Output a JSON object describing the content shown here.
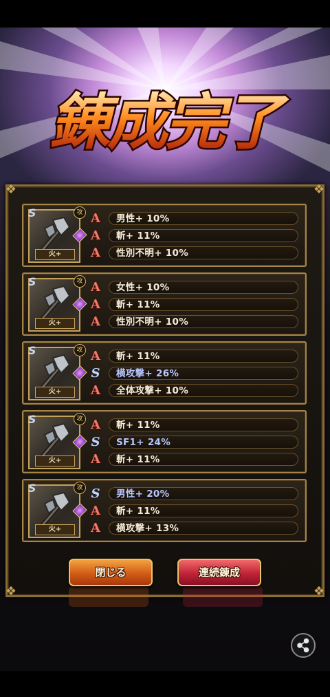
{
  "title": "錬成完了",
  "cards": [
    {
      "element_label": "火+",
      "badge": "攻",
      "rows": [
        {
          "rank": "A",
          "text": "男性+ 10%",
          "tone": "normal"
        },
        {
          "rank": "A",
          "text": "斬+ 11%",
          "tone": "normal"
        },
        {
          "rank": "A",
          "text": "性別不明+ 10%",
          "tone": "normal"
        }
      ]
    },
    {
      "element_label": "火+",
      "badge": "攻",
      "rows": [
        {
          "rank": "A",
          "text": "女性+ 10%",
          "tone": "normal"
        },
        {
          "rank": "A",
          "text": "斬+ 11%",
          "tone": "normal"
        },
        {
          "rank": "A",
          "text": "性別不明+ 10%",
          "tone": "normal"
        }
      ]
    },
    {
      "element_label": "火+",
      "badge": "攻",
      "rows": [
        {
          "rank": "A",
          "text": "斬+ 11%",
          "tone": "normal"
        },
        {
          "rank": "S",
          "text": "横攻撃+ 26%",
          "tone": "blue"
        },
        {
          "rank": "A",
          "text": "全体攻撃+ 10%",
          "tone": "normal"
        }
      ]
    },
    {
      "element_label": "火+",
      "badge": "攻",
      "rows": [
        {
          "rank": "A",
          "text": "斬+ 11%",
          "tone": "normal"
        },
        {
          "rank": "S",
          "text": "SF1+ 24%",
          "tone": "blue"
        },
        {
          "rank": "A",
          "text": "斬+ 11%",
          "tone": "normal"
        }
      ]
    },
    {
      "element_label": "火+",
      "badge": "攻",
      "rows": [
        {
          "rank": "S",
          "text": "男性+ 20%",
          "tone": "blue"
        },
        {
          "rank": "A",
          "text": "斬+ 11%",
          "tone": "normal"
        },
        {
          "rank": "A",
          "text": "横攻撃+ 13%",
          "tone": "normal"
        }
      ]
    }
  ],
  "buttons": {
    "close_label": "閉じる",
    "continue_label": "連続錬成"
  },
  "icons": {
    "share": "share-icon",
    "weapon": "axe-icon",
    "gem": "purple-gem-icon"
  },
  "colors": {
    "rank_a": "#f07a6a",
    "rank_s": "#c9d3f2",
    "frame_gold": "#a68447",
    "blue_text": "#b8c6ff"
  }
}
